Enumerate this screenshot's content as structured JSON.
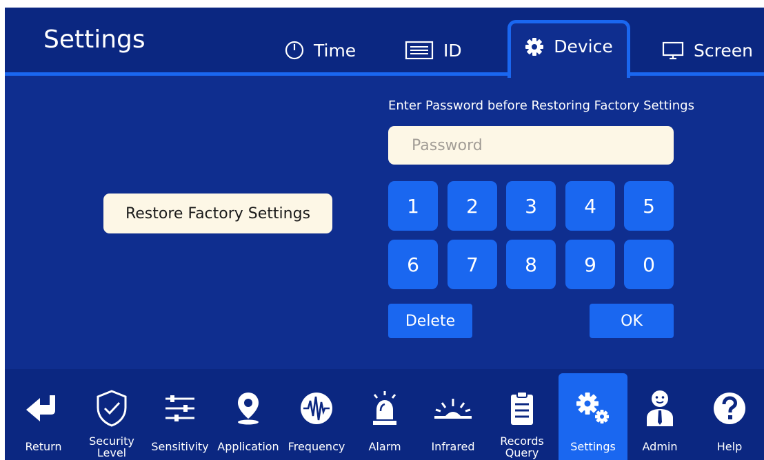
{
  "header": {
    "title": "Settings",
    "tabs": [
      {
        "label": "Time",
        "icon": "clock-icon"
      },
      {
        "label": "ID",
        "icon": "id-card-icon"
      },
      {
        "label": "Device",
        "icon": "gear-icon",
        "active": true
      },
      {
        "label": "Screen",
        "icon": "monitor-icon"
      }
    ]
  },
  "main": {
    "restore_label": "Restore Factory Settings",
    "prompt": "Enter Password before Restoring Factory Settings",
    "password": {
      "value": "",
      "placeholder": "Password"
    },
    "keys": [
      "1",
      "2",
      "3",
      "4",
      "5",
      "6",
      "7",
      "8",
      "9",
      "0"
    ],
    "delete_label": "Delete",
    "ok_label": "OK"
  },
  "nav": {
    "items": [
      {
        "label": "Return",
        "icon": "return-arrow-icon"
      },
      {
        "label": "Security Level",
        "icon": "shield-check-icon"
      },
      {
        "label": "Sensitivity",
        "icon": "sliders-icon"
      },
      {
        "label": "Application",
        "icon": "location-pin-icon"
      },
      {
        "label": "Frequency",
        "icon": "waveform-icon"
      },
      {
        "label": "Alarm",
        "icon": "alarm-siren-icon"
      },
      {
        "label": "Infrared",
        "icon": "infrared-icon"
      },
      {
        "label": "Records Query",
        "icon": "clipboard-icon"
      },
      {
        "label": "Settings",
        "icon": "gears-icon",
        "active": true
      },
      {
        "label": "Admin",
        "icon": "admin-user-icon"
      },
      {
        "label": "Help",
        "icon": "help-icon"
      }
    ]
  },
  "colors": {
    "background": "#0f2e8f",
    "header": "#0b2781",
    "accent": "#1a67f0",
    "cream": "#fdf7e6"
  }
}
